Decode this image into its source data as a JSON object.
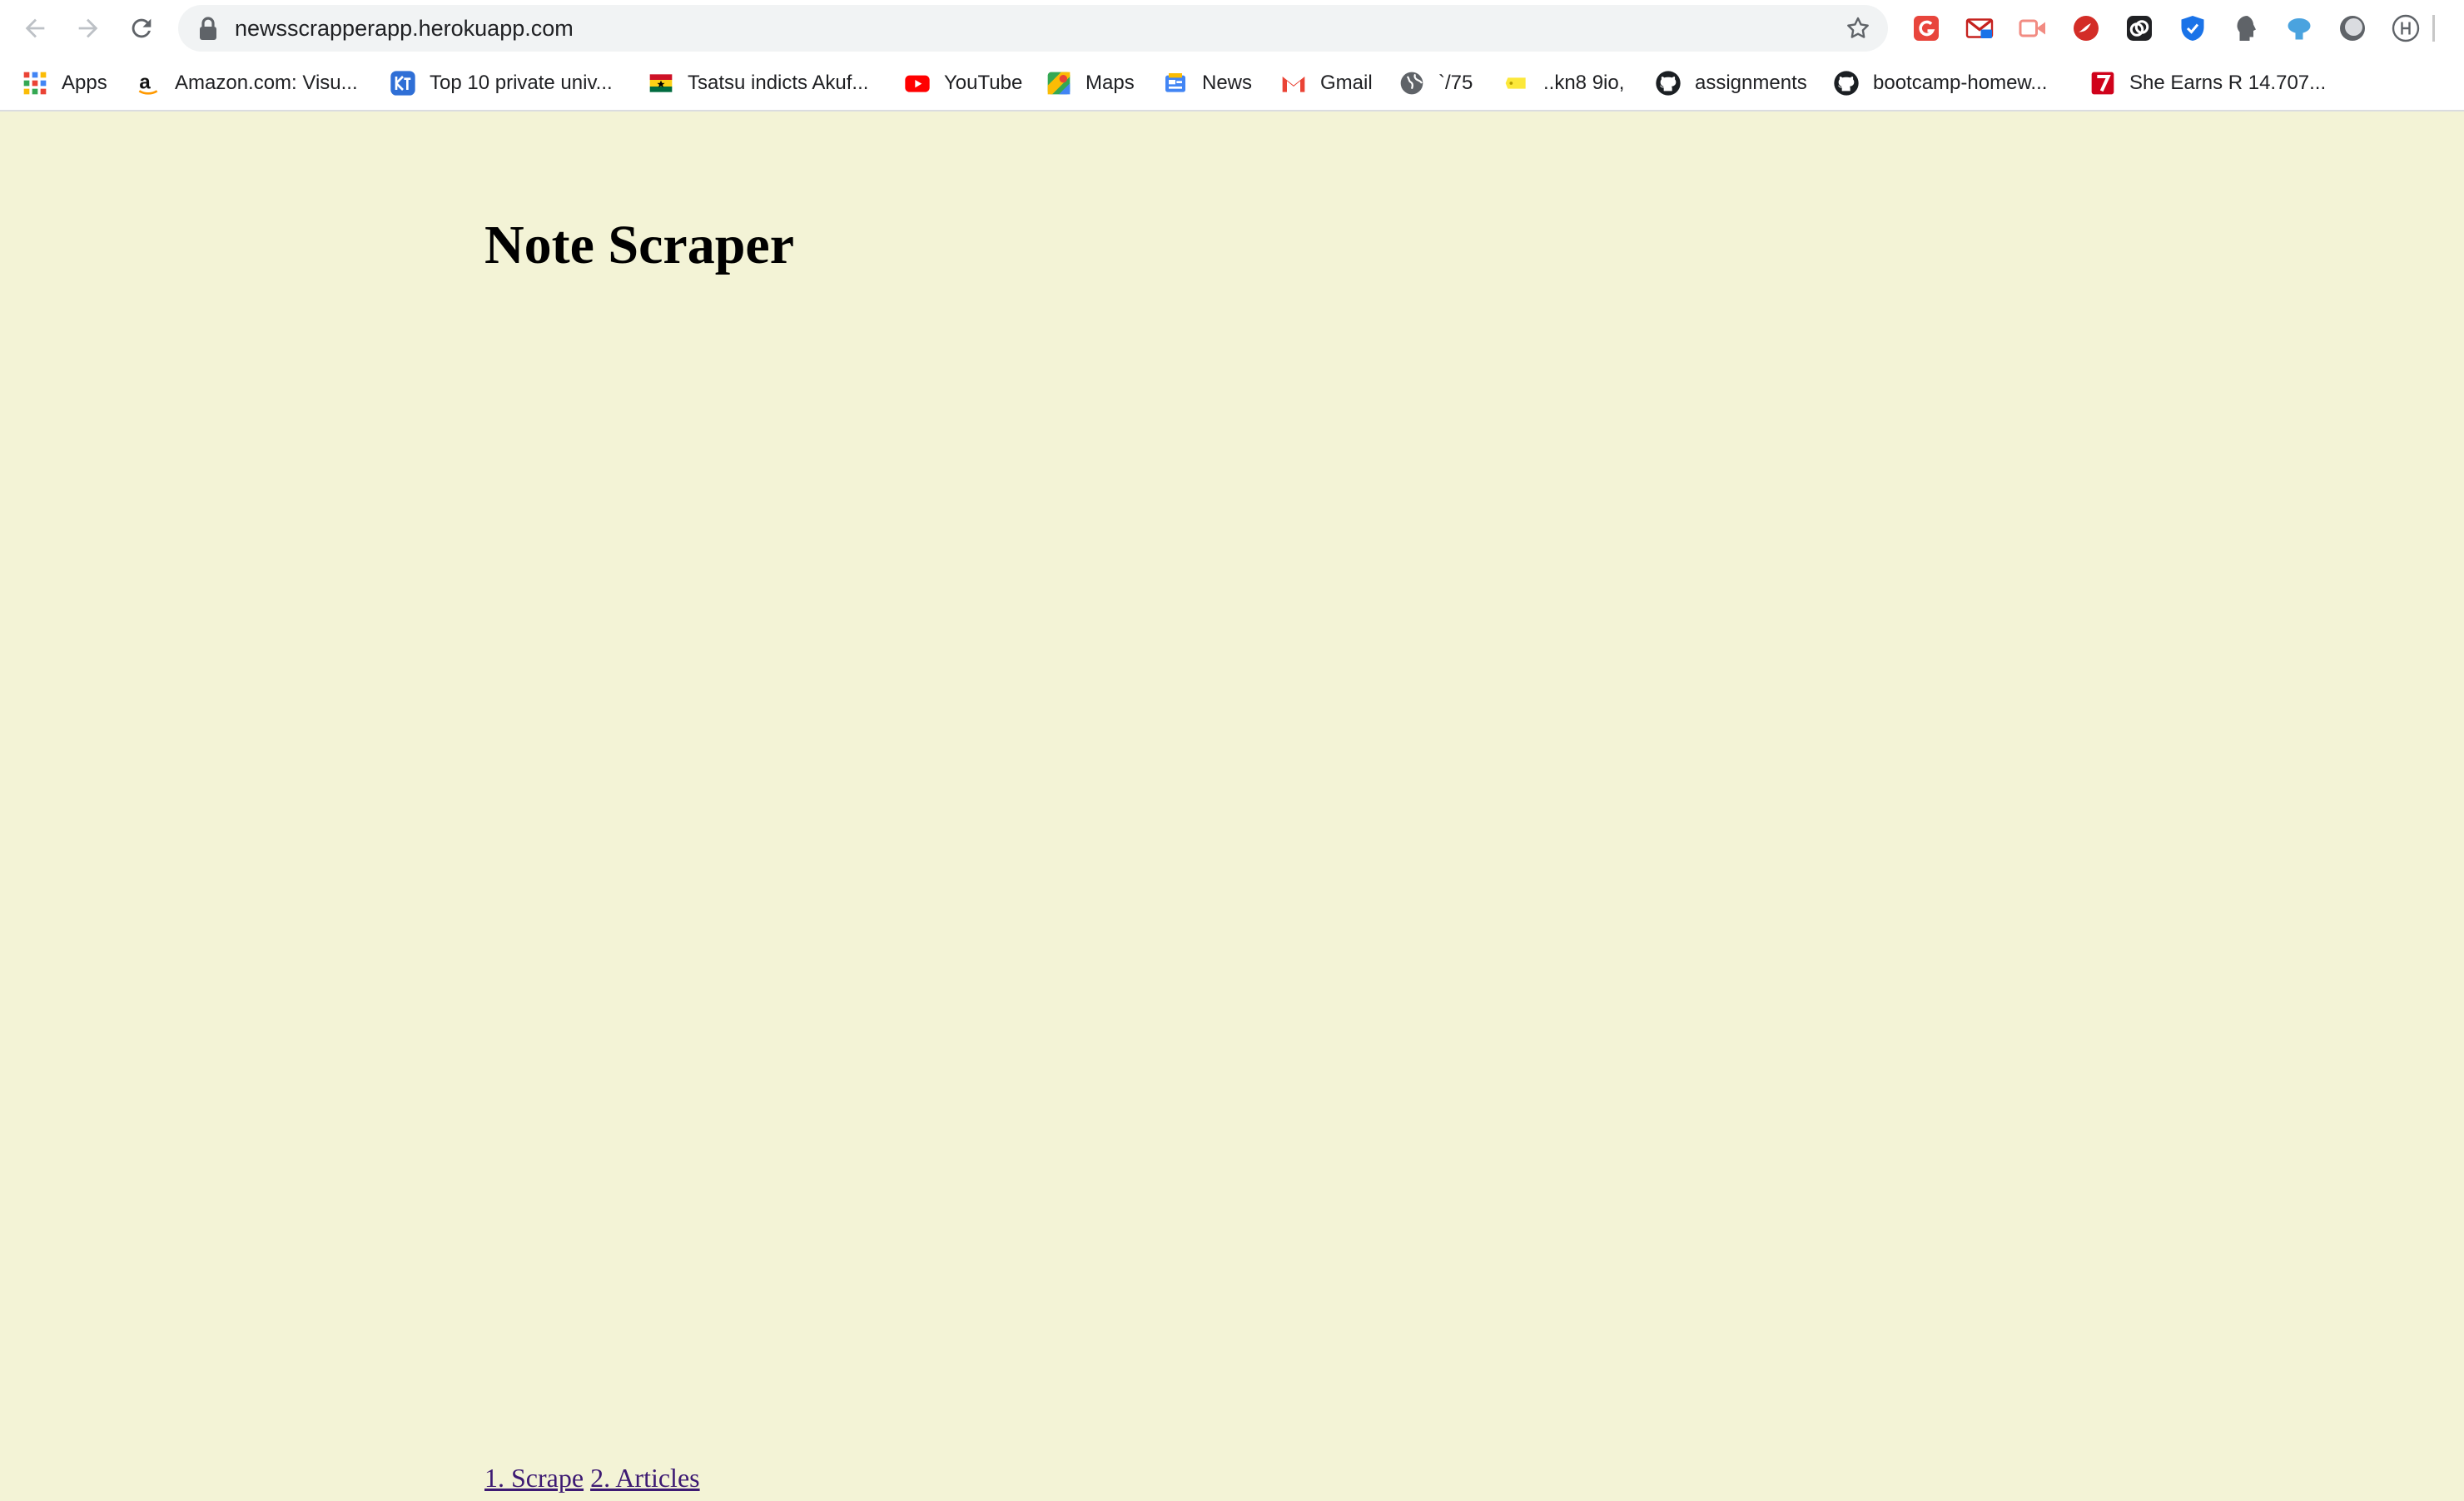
{
  "browser": {
    "url": "newsscrapperapp.herokuapp.com",
    "nav_icons": [
      "back-arrow-icon",
      "forward-arrow-icon",
      "reload-icon"
    ],
    "extensions": [
      "grammarly-icon",
      "gmail-checker-icon",
      "video-extension-icon",
      "lastpass-icon",
      "link-extension-icon",
      "shield-extension-icon",
      "head-profile-icon",
      "fish-extension-icon",
      "sphere-extension-icon",
      "h-circle-icon"
    ]
  },
  "bookmarks": [
    {
      "label": "Apps",
      "icon": "apps-grid-icon"
    },
    {
      "label": "Amazon.com: Visu...",
      "icon": "amazon-icon"
    },
    {
      "label": "Top 10 private univ...",
      "icon": "kt-icon"
    },
    {
      "label": "Tsatsu indicts Akuf...",
      "icon": "ghana-flag-icon"
    },
    {
      "label": "YouTube",
      "icon": "youtube-icon"
    },
    {
      "label": "Maps",
      "icon": "maps-icon"
    },
    {
      "label": "News",
      "icon": "news-icon"
    },
    {
      "label": "Gmail",
      "icon": "gmail-icon"
    },
    {
      "label": "`/75",
      "icon": "globe-icon"
    },
    {
      "label": "..kn8 9io,",
      "icon": "yellow-tag-icon"
    },
    {
      "label": "assignments",
      "icon": "github-icon"
    },
    {
      "label": "bootcamp-homew...",
      "icon": "github-icon"
    },
    {
      "label": "She Earns R 14.707...",
      "icon": "red-seven-icon"
    }
  ],
  "page": {
    "title": "Note Scraper",
    "links": [
      {
        "label": "1. Scrape"
      },
      {
        "label": "2. Articles"
      }
    ]
  },
  "colors": {
    "page_background": "#f3f3d6",
    "link_color": "#3d1a73"
  }
}
